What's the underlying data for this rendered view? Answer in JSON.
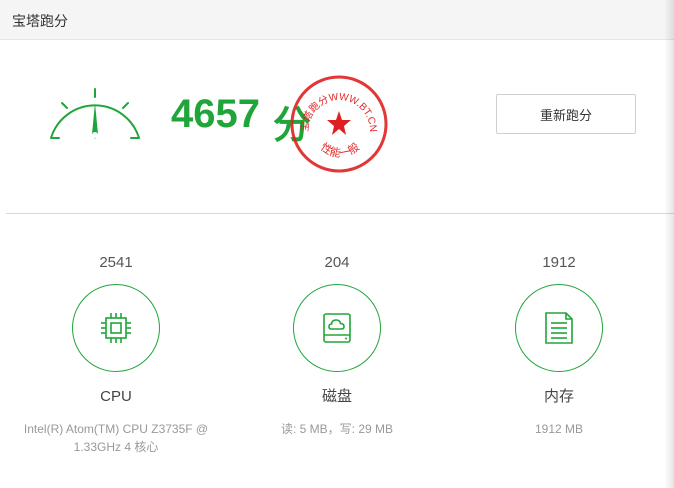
{
  "header": {
    "title": "宝塔跑分"
  },
  "summary": {
    "score": "4657",
    "unit": "分",
    "rerun_label": "重新跑分",
    "stamp": {
      "top_text": "宝塔跑分WWW.BT.CN",
      "bottom_text": "性能一般"
    }
  },
  "metrics": [
    {
      "score": "2541",
      "name": "CPU",
      "desc": "Intel(R) Atom(TM) CPU Z3735F @ 1.33GHz 4 核心",
      "icon": "cpu-chip-icon"
    },
    {
      "score": "204",
      "name": "磁盘",
      "desc": "读: 5 MB，写: 29 MB",
      "icon": "disk-cloud-icon"
    },
    {
      "score": "1912",
      "name": "内存",
      "desc": "1912 MB",
      "icon": "memory-document-icon"
    }
  ],
  "colors": {
    "accent": "#20a53a",
    "stamp": "#e02020"
  }
}
